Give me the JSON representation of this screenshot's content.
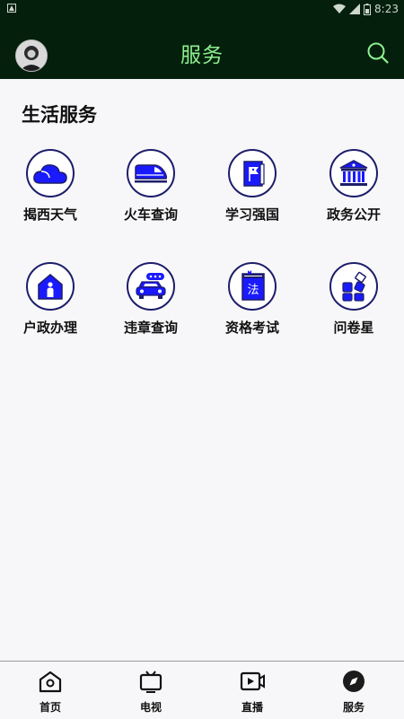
{
  "status_bar": {
    "time": "8:23"
  },
  "header": {
    "title": "服务"
  },
  "section": {
    "title": "生活服务"
  },
  "services": [
    {
      "label": "揭西天气",
      "icon": "cloud-icon"
    },
    {
      "label": "火车查询",
      "icon": "train-icon"
    },
    {
      "label": "学习强国",
      "icon": "book-flag-icon"
    },
    {
      "label": "政务公开",
      "icon": "government-building-icon"
    },
    {
      "label": "户政办理",
      "icon": "house-person-icon"
    },
    {
      "label": "违章查询",
      "icon": "car-icon"
    },
    {
      "label": "资格考试",
      "icon": "law-book-icon"
    },
    {
      "label": "问卷星",
      "icon": "blocks-icon"
    }
  ],
  "bottom_nav": [
    {
      "label": "首页",
      "icon": "home-icon"
    },
    {
      "label": "电视",
      "icon": "tv-icon"
    },
    {
      "label": "直播",
      "icon": "video-icon"
    },
    {
      "label": "服务",
      "icon": "compass-icon"
    }
  ],
  "colors": {
    "header_bg": "#04200d",
    "title": "#8ef08e",
    "icon_blue": "#1a1aff",
    "icon_navy": "#1d1d6b"
  }
}
